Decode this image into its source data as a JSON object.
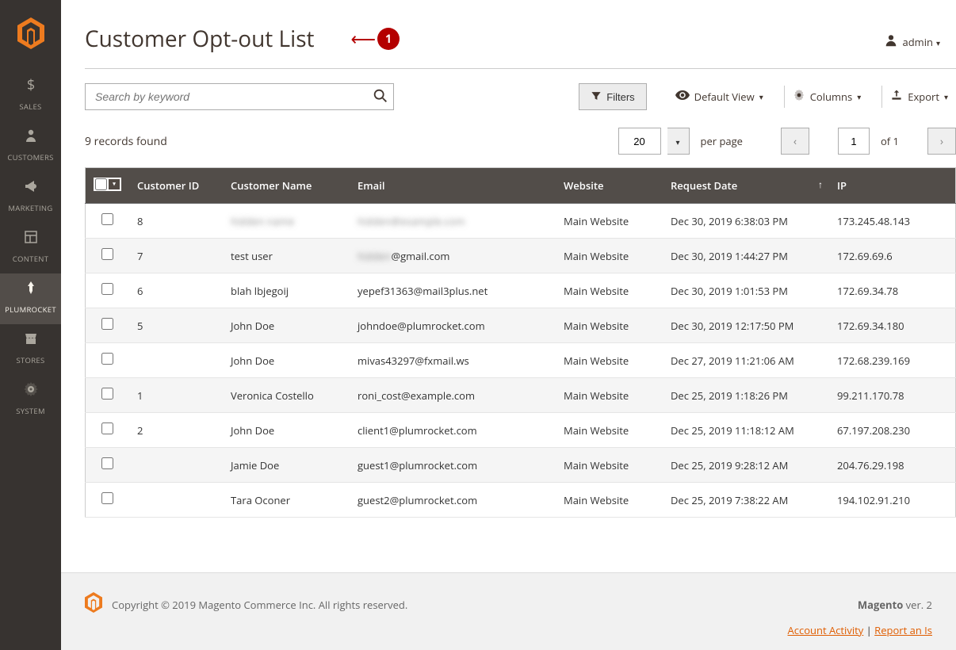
{
  "sidebar": {
    "items": [
      {
        "label": "SALES"
      },
      {
        "label": "CUSTOMERS"
      },
      {
        "label": "MARKETING"
      },
      {
        "label": "CONTENT"
      },
      {
        "label": "PLUMROCKET"
      },
      {
        "label": "STORES"
      },
      {
        "label": "SYSTEM"
      }
    ]
  },
  "header": {
    "title": "Customer Opt-out List",
    "admin_label": "admin",
    "annotation_number": "1"
  },
  "toolbar": {
    "search_placeholder": "Search by keyword",
    "filters_label": "Filters",
    "default_view_label": "Default View",
    "columns_label": "Columns",
    "export_label": "Export"
  },
  "records": {
    "found_text": "9 records found",
    "page_size": "20",
    "per_page_label": "per page",
    "current_page": "1",
    "of_label": "of 1"
  },
  "grid": {
    "columns": {
      "id": "Customer ID",
      "name": "Customer Name",
      "email": "Email",
      "website": "Website",
      "date": "Request Date",
      "ip": "IP"
    },
    "rows": [
      {
        "id": "8",
        "name_blur": "hidden name",
        "email_blur": "hidden@example.com",
        "email_suffix": "",
        "website": "Main Website",
        "date": "Dec 30, 2019 6:38:03 PM",
        "ip": "173.245.48.143"
      },
      {
        "id": "7",
        "name": "test user",
        "email_blur": "hidden",
        "email_suffix": "@gmail.com",
        "website": "Main Website",
        "date": "Dec 30, 2019 1:44:27 PM",
        "ip": "172.69.69.6"
      },
      {
        "id": "6",
        "name": "blah lbjegoij",
        "email": "yepef31363@mail3plus.net",
        "website": "Main Website",
        "date": "Dec 30, 2019 1:01:53 PM",
        "ip": "172.69.34.78"
      },
      {
        "id": "5",
        "name": "John Doe",
        "email": "johndoe@plumrocket.com",
        "website": "Main Website",
        "date": "Dec 30, 2019 12:17:50 PM",
        "ip": "172.69.34.180"
      },
      {
        "id": "",
        "name": "John Doe",
        "email": "mivas43297@fxmail.ws",
        "website": "Main Website",
        "date": "Dec 27, 2019 11:21:06 AM",
        "ip": "172.68.239.169"
      },
      {
        "id": "1",
        "name": "Veronica Costello",
        "email": "roni_cost@example.com",
        "website": "Main Website",
        "date": "Dec 25, 2019 1:18:26 PM",
        "ip": "99.211.170.78"
      },
      {
        "id": "2",
        "name": "John Doe",
        "email": "client1@plumrocket.com",
        "website": "Main Website",
        "date": "Dec 25, 2019 11:18:12 AM",
        "ip": "67.197.208.230"
      },
      {
        "id": "",
        "name": "Jamie Doe",
        "email": "guest1@plumrocket.com",
        "website": "Main Website",
        "date": "Dec 25, 2019 9:28:12 AM",
        "ip": "204.76.29.198"
      },
      {
        "id": "",
        "name": "Tara Oconer",
        "email": "guest2@plumrocket.com",
        "website": "Main Website",
        "date": "Dec 25, 2019 7:38:22 AM",
        "ip": "194.102.91.210"
      }
    ]
  },
  "footer": {
    "copyright": "Copyright © 2019 Magento Commerce Inc. All rights reserved.",
    "version_brand": "Magento",
    "version_text": " ver. 2",
    "link1": "Account Activity",
    "link_sep": " | ",
    "link2": "Report an Is"
  }
}
